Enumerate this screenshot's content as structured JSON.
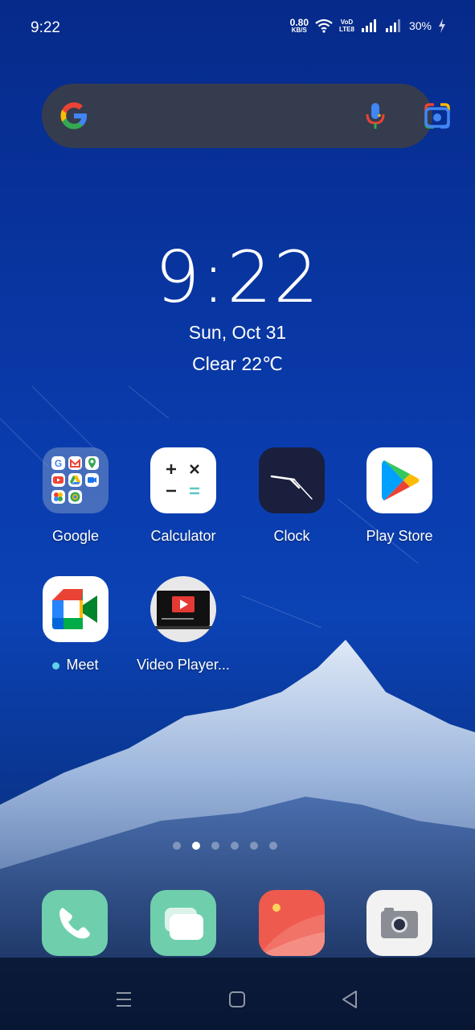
{
  "status_bar": {
    "time": "9:22",
    "net_speed_value": "0.80",
    "net_speed_unit": "KB/S",
    "volte_top": "VoD",
    "volte_bottom": "LTE8",
    "battery": "30%"
  },
  "search": {
    "g_icon": "google-g-icon",
    "mic_icon": "microphone-icon",
    "lens_icon": "google-lens-icon"
  },
  "clock_widget": {
    "time": "9:22",
    "date": "Sun, Oct 31",
    "weather": "Clear 22℃"
  },
  "apps": {
    "row1": [
      {
        "label": "Google"
      },
      {
        "label": "Calculator"
      },
      {
        "label": "Clock"
      },
      {
        "label": "Play Store"
      }
    ],
    "row2": [
      {
        "label": "Meet"
      },
      {
        "label": "Video Player..."
      }
    ]
  },
  "dock": [
    {
      "icon": "phone-icon"
    },
    {
      "icon": "messages-icon"
    },
    {
      "icon": "gallery-icon"
    },
    {
      "icon": "camera-icon"
    }
  ],
  "page_indicator": {
    "pages": 6,
    "active": 2
  },
  "nav_bar": {
    "menu_icon": "menu-icon",
    "home_icon": "home-icon",
    "back_icon": "back-icon"
  },
  "colors": {
    "wallpaper_top": "#062a8a",
    "search_bg": "#3a3e48",
    "phone": "#6fcfac",
    "messages": "#6fcfac",
    "gallery": "#ee5a4e"
  }
}
